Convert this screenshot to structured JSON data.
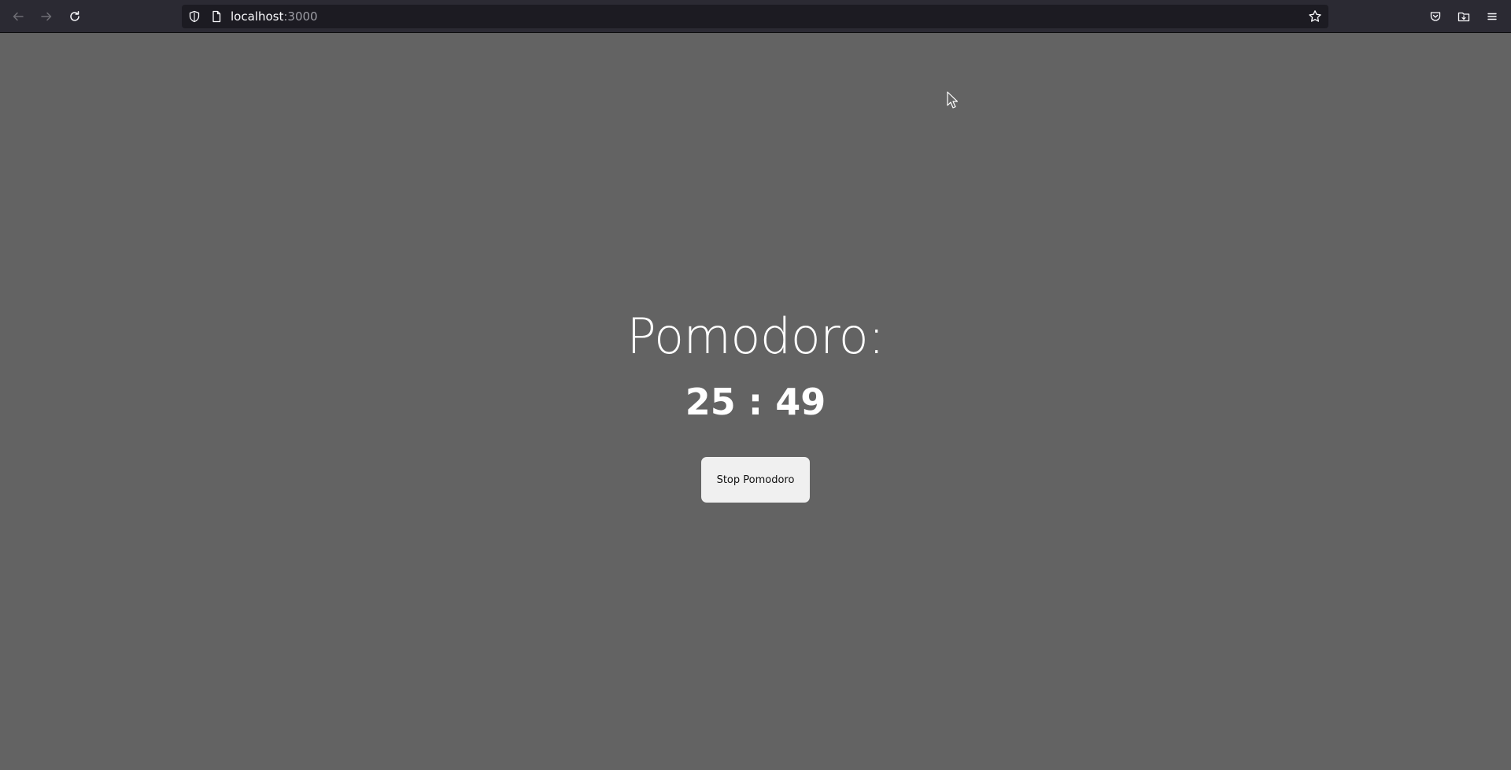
{
  "browser": {
    "url_host": "localhost",
    "url_port": ":3000",
    "icons": {
      "back": "arrow-left-icon",
      "forward": "arrow-right-icon",
      "reload": "reload-icon",
      "shield": "shield-icon",
      "page": "page-icon",
      "bookmark": "star-icon",
      "pocket": "pocket-icon",
      "downloads": "folder-icon",
      "menu": "hamburger-menu-icon"
    }
  },
  "pomodoro": {
    "title": "Pomodoro:",
    "timer": "25 : 49",
    "stop_label": "Stop Pomodoro"
  },
  "colors": {
    "page_background": "#636363",
    "browser_bar": "#2b2a33",
    "urlbar": "#1c1b22",
    "text": "#ffffff",
    "button_background": "#f0f0f0"
  }
}
